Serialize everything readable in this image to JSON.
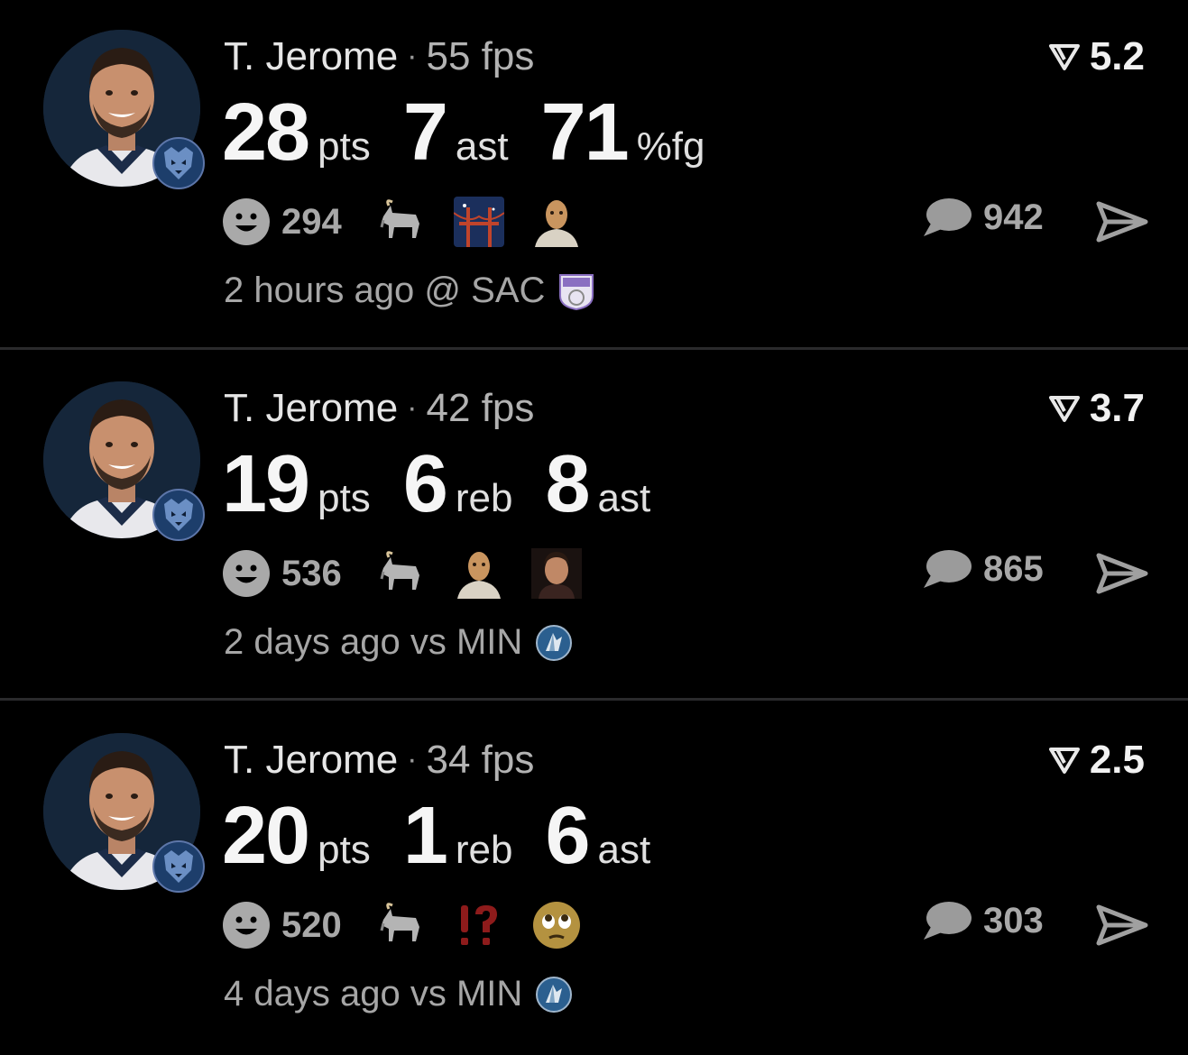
{
  "posts": [
    {
      "player": "T. Jerome",
      "separator": "·",
      "fps": "55 fps",
      "rating": "5.2",
      "stats": [
        {
          "value": "28",
          "unit": "pts"
        },
        {
          "value": "7",
          "unit": "ast"
        },
        {
          "value": "71",
          "unit": "%fg"
        }
      ],
      "reaction_count": "294",
      "emojis": [
        "goat-emoji",
        "bridge-at-night-emoji",
        "masked-face-emoji"
      ],
      "comment_count": "942",
      "time_ago": "2 hours ago",
      "venue": "@",
      "opponent": "SAC"
    },
    {
      "player": "T. Jerome",
      "separator": "·",
      "fps": "42 fps",
      "rating": "3.7",
      "stats": [
        {
          "value": "19",
          "unit": "pts"
        },
        {
          "value": "6",
          "unit": "reb"
        },
        {
          "value": "8",
          "unit": "ast"
        }
      ],
      "reaction_count": "536",
      "emojis": [
        "goat-emoji",
        "masked-face-emoji",
        "person-photo-emoji"
      ],
      "comment_count": "865",
      "time_ago": "2 days ago",
      "venue": "vs",
      "opponent": "MIN"
    },
    {
      "player": "T. Jerome",
      "separator": "·",
      "fps": "34 fps",
      "rating": "2.5",
      "stats": [
        {
          "value": "20",
          "unit": "pts"
        },
        {
          "value": "1",
          "unit": "reb"
        },
        {
          "value": "6",
          "unit": "ast"
        }
      ],
      "reaction_count": "520",
      "emojis": [
        "goat-emoji",
        "interrobang-emoji",
        "pleading-face-emoji"
      ],
      "comment_count": "303",
      "time_ago": "4 days ago",
      "venue": "vs",
      "opponent": "MIN"
    }
  ],
  "colors": {
    "background": "#000000",
    "muted_text": "#a6a6a6",
    "icon_gray": "#9b9b9b",
    "grizzlies_navy": "#1d3e6b",
    "kings_purple": "#8a6fc1",
    "wolves_blue": "#2b5f8f"
  }
}
